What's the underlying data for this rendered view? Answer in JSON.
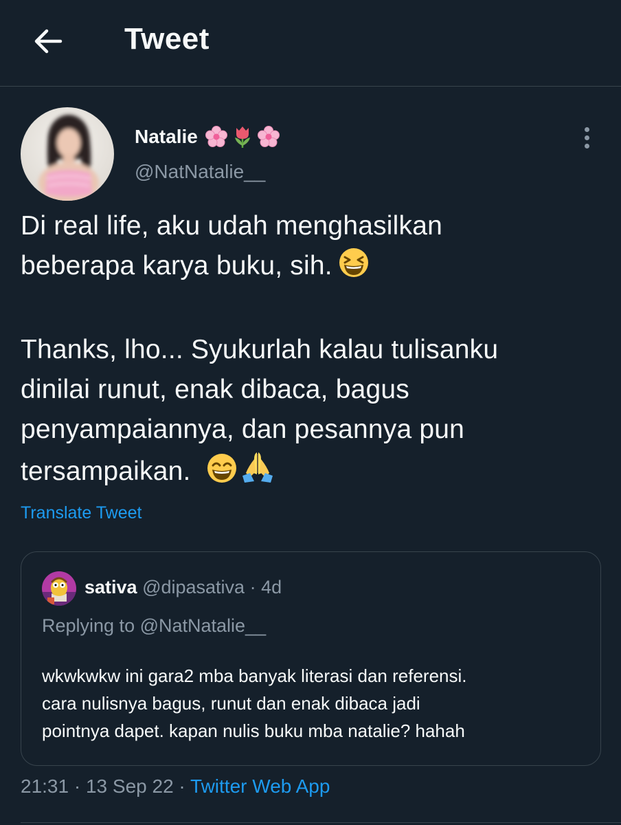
{
  "header": {
    "title": "Tweet",
    "back_icon": "arrow-left-icon"
  },
  "tweet": {
    "display_name": "Natalie",
    "name_emojis": [
      "cherry-blossom-icon",
      "tulip-icon",
      "cherry-blossom-icon"
    ],
    "handle": "@NatNatalie__",
    "text_lines": [
      "Di real life, aku udah menghasilkan",
      "beberapa karya buku, sih.",
      "Thanks, lho... Syukurlah kalau tulisanku",
      "dinilai runut, enak dibaca, bagus",
      "penyampaiannya, dan pesannya pun",
      "tersampaikan."
    ],
    "translate_label": "Translate Tweet"
  },
  "quote": {
    "name": "sativa",
    "handle": "@dipasativa",
    "separator": "·",
    "time": "4d",
    "replying_to": "Replying to @NatNatalie__",
    "text_lines": [
      "wkwkwkw ini gara2 mba banyak literasi dan referensi.",
      "cara nulisnya bagus, runut dan enak dibaca jadi",
      "pointnya dapet. kapan nulis buku mba natalie? hahah"
    ]
  },
  "meta": {
    "time": "21:31",
    "separator": "·",
    "date": "13 Sep 22",
    "source": "Twitter Web App"
  },
  "colors": {
    "background": "#15202b",
    "text": "#f7f9f9",
    "secondary": "#8b98a5",
    "accent": "#1d9bf0",
    "border": "#38444d"
  }
}
